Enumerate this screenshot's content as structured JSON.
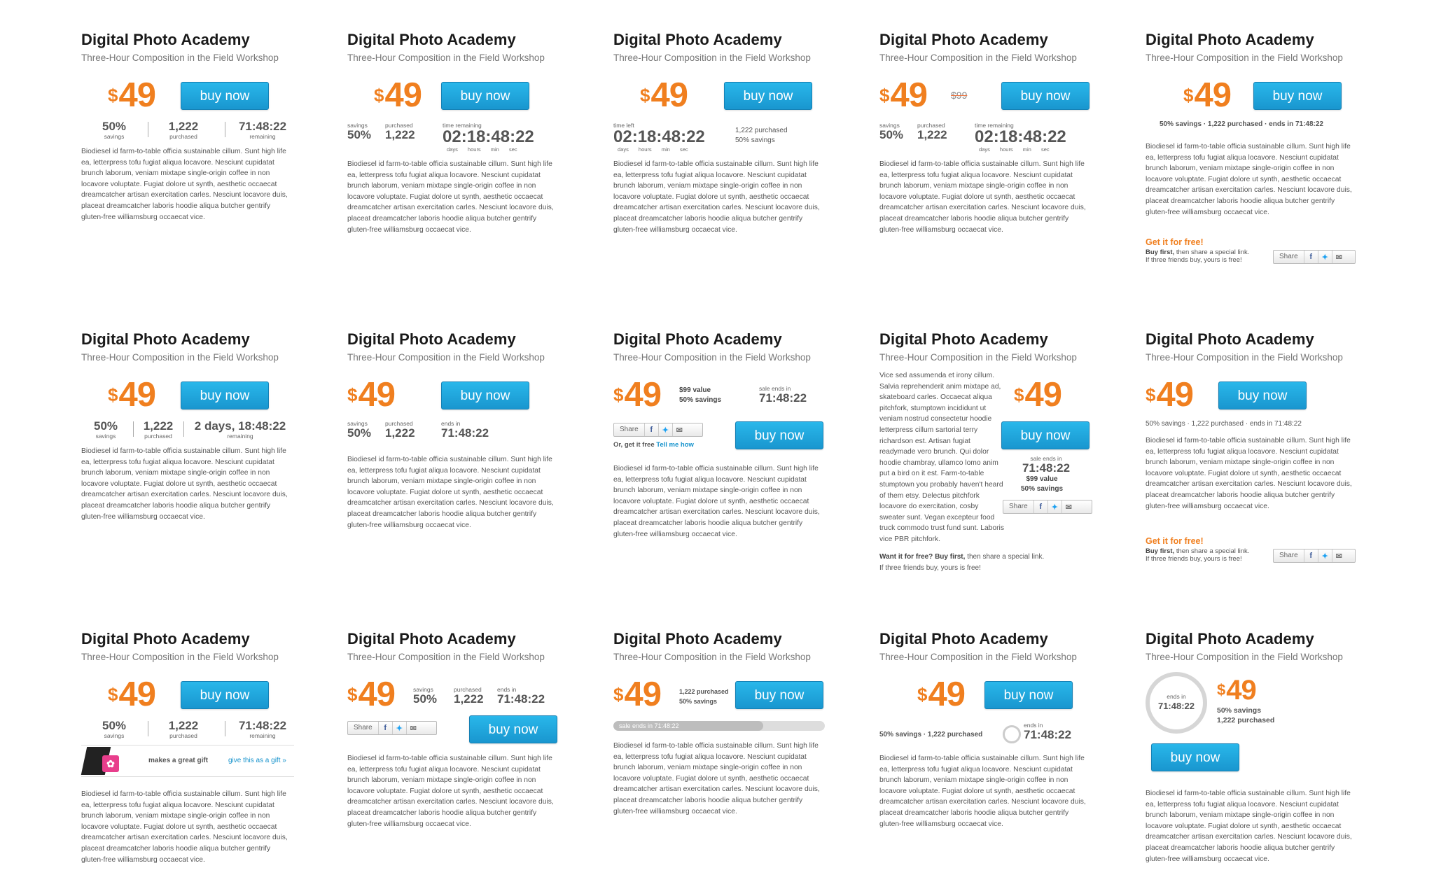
{
  "brand": "Digital Photo Academy",
  "subtitle": "Three-Hour Composition in the Field Workshop",
  "currency": "$",
  "price": "49",
  "old_price": "$99",
  "buy_label": "buy now",
  "savings": "50%",
  "purchased": "1,222",
  "remaining": "71:48:22",
  "timer_full": "02:18:48:22",
  "remaining_days": "2 days, 18:48:22",
  "labels": {
    "savings": "savings",
    "purchased": "purchased",
    "remaining": "remaining",
    "time_remaining": "time remaining",
    "time_left": "time left",
    "timer_units": "days hours min sec",
    "ends_in": "ends in",
    "sale_ends_in": "sale ends in",
    "value": "value",
    "share": "Share"
  },
  "lines": {
    "purchased_line": "1,222 purchased",
    "savings_line": "50% savings",
    "value_line": "$99 value",
    "inline_summary": "50% savings · 1,222 purchased · ends in 71:48:22",
    "inline_summary_short": "50% savings · 1,222 purchased",
    "ends_in_inline": "ends in",
    "sale_ends_bar": "sale ends in 71:48:22"
  },
  "get_free": {
    "title": "Get it for free!",
    "line1_bold": "Buy first,",
    "line1_rest": " then share a special link.",
    "line2": "If three friends buy, yours is free!",
    "or_get_it_free": "Or, get it free",
    "tell_me_how": "Tell me how",
    "want_it_free": "Want it for free?",
    "buy_first": "Buy first,",
    "then_share": " then share a special link.",
    "three_friends": "If three friends buy, yours is free!"
  },
  "gift": {
    "makes_great_gift": "makes a great gift",
    "give_as_gift": "give this as a gift »"
  },
  "description": "Biodiesel id farm-to-table officia sustainable cillum. Sunt high life ea, letterpress tofu fugiat aliqua locavore. Nesciunt cupidatat brunch laborum, veniam mixtape single-origin coffee in non locavore voluptate. Fugiat dolore ut synth, aesthetic occaecat dreamcatcher artisan exercitation carles. Nesciunt locavore duis, placeat dreamcatcher laboris hoodie aliqua butcher gentrify gluten-free williamsburg occaecat vice.",
  "description_alt": "Vice sed assumenda et irony cillum. Salvia reprehenderit anim mixtape ad, skateboard carles. Occaecat aliqua pitchfork, stumptown incididunt ut veniam nostrud consectetur hoodie letterpress cillum sartorial terry richardson est. Artisan fugiat readymade vero brunch. Qui dolor hoodie chambray, ullamco lomo anim put a bird on it est. Farm-to-table stumptown you probably haven't heard of them etsy. Delectus pitchfork locavore do exercitation, cosby sweater sunt. Vegan excepteur food truck commodo trust fund sunt. Laboris vice PBR pitchfork.",
  "colors": {
    "accent": "#f07f1f",
    "button": "#1aa6dd",
    "link": "#1592cc"
  }
}
